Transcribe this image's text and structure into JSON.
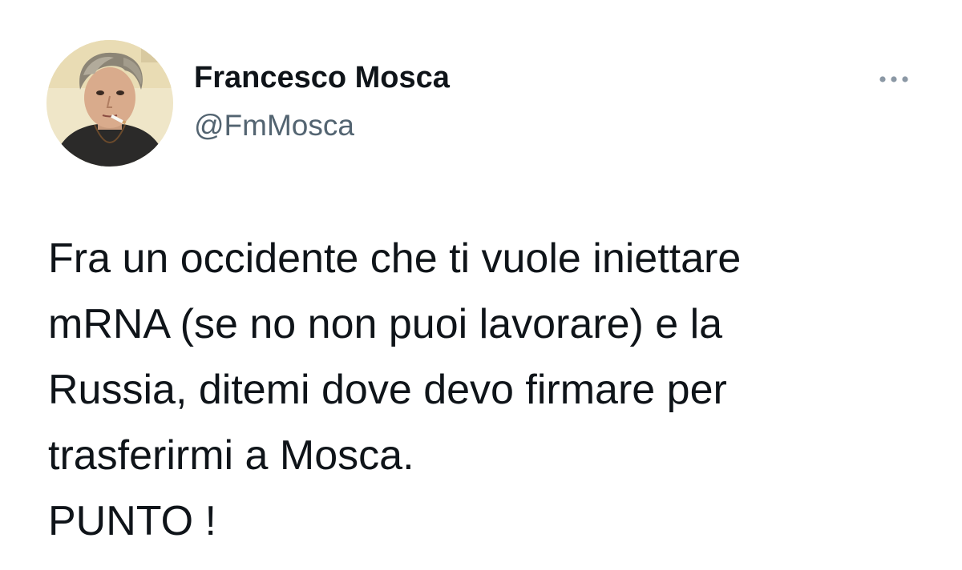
{
  "tweet": {
    "author": {
      "display_name": "Francesco Mosca",
      "handle": "@FmMosca",
      "avatar": "profile-photo"
    },
    "more_icon": "more-horizontal-icon",
    "text": "Fra un occidente che ti vuole iniettare\nmRNA (se no non puoi lavorare) e la\nRussia, ditemi dove devo firmare per\ntrasferirmi a Mosca.\nPUNTO !"
  },
  "colors": {
    "primary_text": "#0f1419",
    "secondary_text": "#536471",
    "icon": "#8b98a5",
    "background": "#ffffff"
  }
}
